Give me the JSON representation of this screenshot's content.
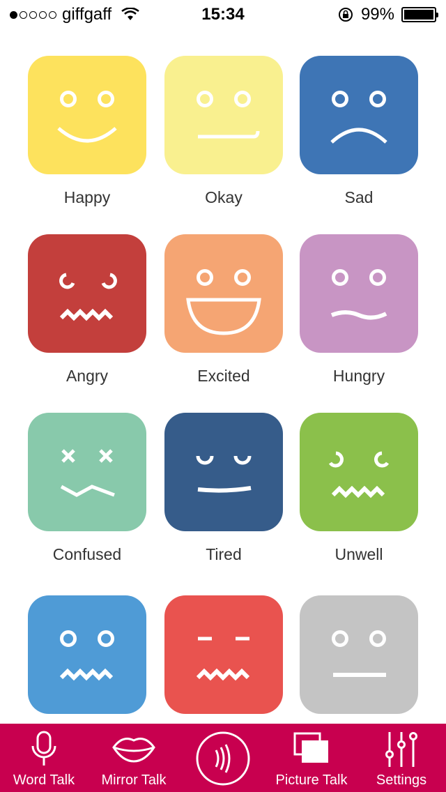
{
  "status_bar": {
    "carrier": "giffgaff",
    "time": "15:34",
    "battery": "99%",
    "signal_bars_filled": 1,
    "signal_bars_total": 5,
    "battery_level": 0.99
  },
  "moods": [
    {
      "label": "Happy",
      "color": "#fde25d",
      "face": "happy"
    },
    {
      "label": "Okay",
      "color": "#f9f08f",
      "face": "okay"
    },
    {
      "label": "Sad",
      "color": "#3e75b5",
      "face": "sad"
    },
    {
      "label": "Angry",
      "color": "#c33f3c",
      "face": "angry"
    },
    {
      "label": "Excited",
      "color": "#f5a573",
      "face": "excited"
    },
    {
      "label": "Hungry",
      "color": "#c895c4",
      "face": "hungry"
    },
    {
      "label": "Confused",
      "color": "#88c9ab",
      "face": "confused"
    },
    {
      "label": "Tired",
      "color": "#365c8a",
      "face": "tired"
    },
    {
      "label": "Unwell",
      "color": "#8bc04b",
      "face": "unwell"
    },
    {
      "label": "",
      "color": "#4f9bd6",
      "face": "nervous"
    },
    {
      "label": "",
      "color": "#e9534f",
      "face": "annoyed"
    },
    {
      "label": "",
      "color": "#c4c4c4",
      "face": "neutral"
    }
  ],
  "tabbar": {
    "color": "#c8004f",
    "tabs": [
      {
        "label": "Word Talk",
        "icon": "microphone-icon"
      },
      {
        "label": "Mirror Talk",
        "icon": "lips-icon"
      },
      {
        "label": "",
        "icon": "speak-waves-icon"
      },
      {
        "label": "Picture Talk",
        "icon": "pictures-icon"
      },
      {
        "label": "Settings",
        "icon": "sliders-icon"
      }
    ]
  }
}
